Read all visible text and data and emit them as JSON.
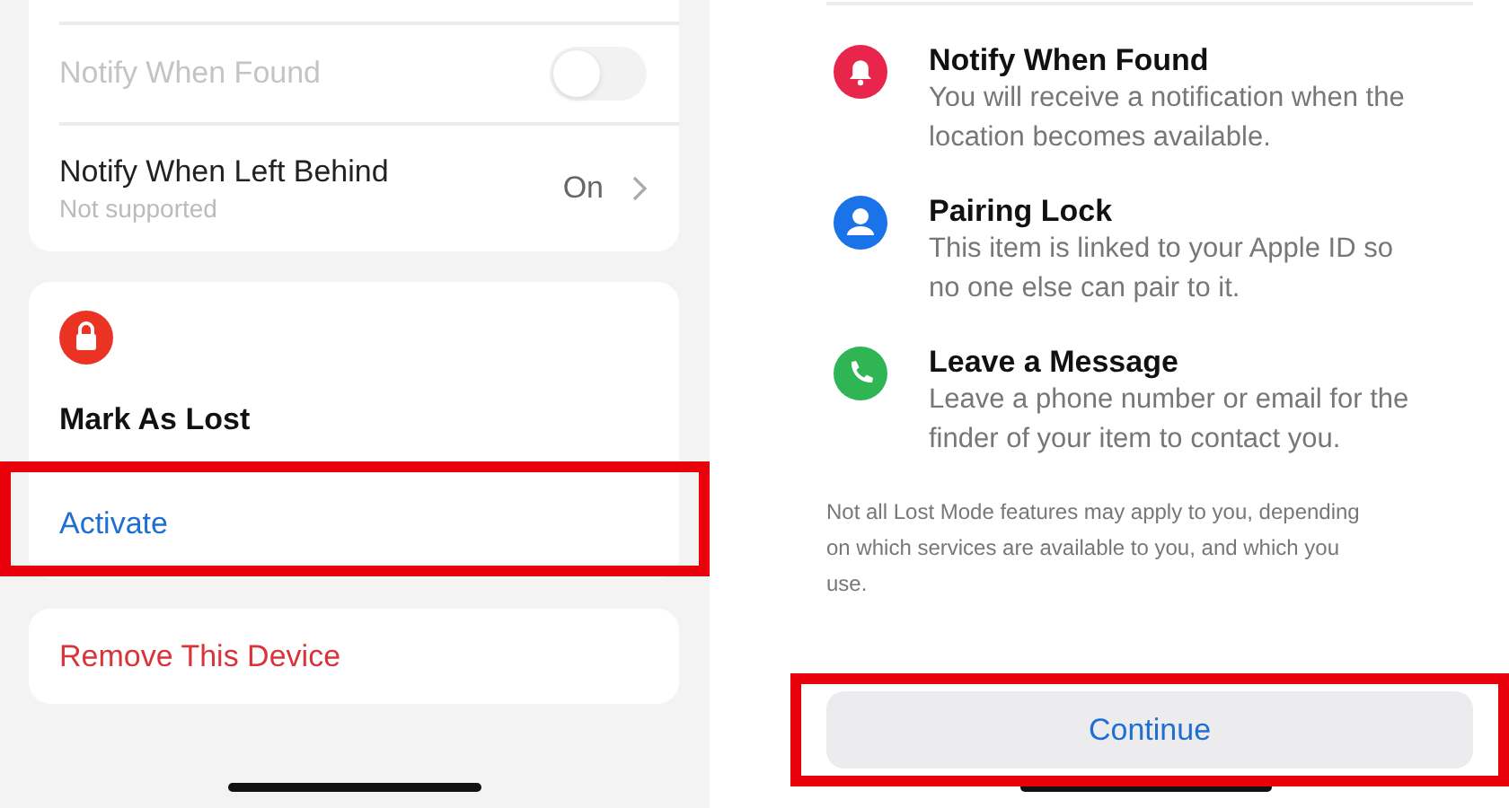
{
  "left_screen": {
    "settings_rows": [
      {
        "kind": "toggle",
        "label": "Notify When Found",
        "disabled": true,
        "on": false
      },
      {
        "kind": "detail",
        "label": "Notify When Left Behind",
        "subtitle": "Not supported",
        "value": "On",
        "disabled": false
      }
    ],
    "lost_card": {
      "title": "Mark As Lost",
      "action": "Activate",
      "highlighted": true
    },
    "remove_action": "Remove This Device"
  },
  "right_screen": {
    "features": [
      {
        "kind": "bell",
        "color": "#e8264b",
        "title": "Notify When Found",
        "description": "You will receive a notification when the location becomes available."
      },
      {
        "kind": "person",
        "color": "#1a73e8",
        "title": "Pairing Lock",
        "description": "This item is linked to your Apple ID so no one else can pair to it."
      },
      {
        "kind": "phone",
        "color": "#2fb553",
        "title": "Leave a Message",
        "description": "Leave a phone number or email for the finder of your item to contact you."
      }
    ],
    "footnote": "Not all Lost Mode features may apply to you, depending on which services are available to you, and which you use.",
    "continue_button": {
      "label": "Continue",
      "highlighted": true
    }
  }
}
